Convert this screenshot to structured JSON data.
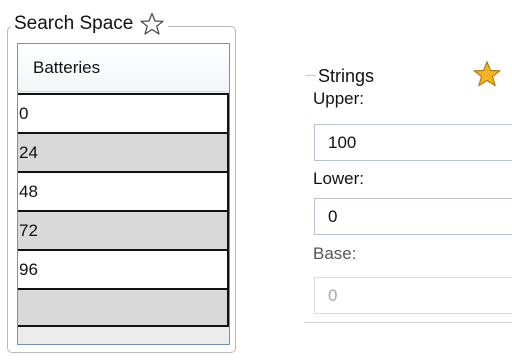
{
  "search_space": {
    "title": "Search Space",
    "favorite_icon": "star-outline-icon",
    "table": {
      "header": "Batteries",
      "rows": [
        "0",
        "24",
        "48",
        "72",
        "96",
        ""
      ]
    }
  },
  "strings": {
    "title": "Strings",
    "favorite_icon": "star-filled-icon",
    "upper": {
      "label": "Upper:",
      "value": "100"
    },
    "lower": {
      "label": "Lower:",
      "value": "0"
    },
    "base": {
      "label": "Base:",
      "value": "0",
      "disabled": true
    }
  },
  "colors": {
    "star_fill": "#f5b324",
    "table_border": "#6f93b8",
    "alt_row": "#d9d9d9"
  }
}
